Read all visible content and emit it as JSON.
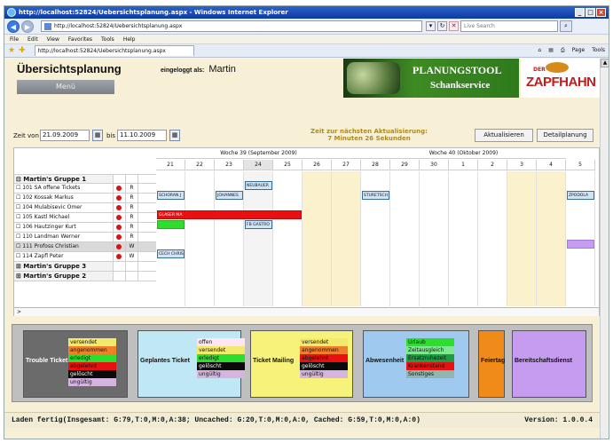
{
  "browser": {
    "title": "http://localhost:52824/Uebersichtsplanung.aspx - Windows Internet Explorer",
    "url": "http://localhost:52824/Uebersichtsplanung.aspx",
    "search_placeholder": "Live Search",
    "menu": [
      "File",
      "Edit",
      "View",
      "Favorites",
      "Tools",
      "Help"
    ],
    "tab_label": "http://localhost:52824/Uebersichtsplanung.aspx",
    "tools": [
      "Page",
      "Tools"
    ]
  },
  "header": {
    "title": "Übersichtsplanung",
    "menu_button": "Menü",
    "login_label": "eingeloggt als:",
    "user": "Martin",
    "banner_line1": "PLANUNGSTOOL",
    "banner_line2": "Schankservice",
    "logo_der": "DER",
    "logo_name": "ZAPFHAHN"
  },
  "toolbar": {
    "from_label": "Zeit von",
    "from_value": "21.09.2009",
    "to_label": "bis",
    "to_value": "11.10.2009",
    "countdown_line1": "Zeit zur nächsten Aktualisierung:",
    "countdown_line2": "7 Minuten 26 Sekunden",
    "refresh_button": "Aktualisieren",
    "detail_button": "Detailplanung"
  },
  "grid": {
    "weeks": [
      {
        "label": "Woche 39 (September 2009)",
        "start": 0,
        "span": 7
      },
      {
        "label": "Woche 40 (Oktober 2009)",
        "start": 7,
        "span": 7
      }
    ],
    "days": [
      "21",
      "22",
      "23",
      "24",
      "25",
      "26",
      "27",
      "28",
      "29",
      "30",
      "1",
      "2",
      "3",
      "4",
      "5"
    ],
    "today_index": 3,
    "weekend_indices": [
      5,
      6,
      12,
      13
    ],
    "rows": [
      {
        "name": "Martin's Gruppe 1",
        "group": true,
        "prefix": "⊟"
      },
      {
        "name": "101 SA offene Tickets",
        "dot": true,
        "status": "R",
        "prefix": "☐"
      },
      {
        "name": "102 Kossak Markus",
        "dot": true,
        "status": "R",
        "prefix": "☐"
      },
      {
        "name": "104 Mulabisevic Omer",
        "dot": true,
        "status": "R",
        "prefix": "☐"
      },
      {
        "name": "105 Kastl Michael",
        "dot": true,
        "status": "R",
        "prefix": "☐"
      },
      {
        "name": "106 Hautzinger Kurt",
        "dot": true,
        "status": "R",
        "prefix": "☐"
      },
      {
        "name": "110 Landman Werner",
        "dot": true,
        "status": "R",
        "prefix": "☐"
      },
      {
        "name": "111 Profoss Christian",
        "dot": true,
        "status": "W",
        "prefix": "☐",
        "highlight": true
      },
      {
        "name": "114 Zapfl Peter",
        "dot": true,
        "status": "W",
        "prefix": "☐"
      },
      {
        "name": "Martin's Gruppe 3",
        "group": true,
        "prefix": "⊞"
      },
      {
        "name": "Martin's Gruppe 2",
        "group": true,
        "prefix": "⊞"
      }
    ],
    "events": [
      {
        "row": 1,
        "start": 3,
        "span": 1,
        "label": "NEUBAUER",
        "kind": "blue"
      },
      {
        "row": 2,
        "start": 0,
        "span": 1,
        "label": "SCHORAN J",
        "kind": "blue"
      },
      {
        "row": 2,
        "start": 2,
        "span": 1,
        "label": "JOHANNES",
        "kind": "blue"
      },
      {
        "row": 2,
        "start": 7,
        "span": 1,
        "label": "STURETSCH",
        "kind": "blue"
      },
      {
        "row": 2,
        "start": 14,
        "span": 1,
        "label": "ZPODOLA",
        "kind": "blue"
      },
      {
        "row": 4,
        "start": 0,
        "span": 5,
        "label": "GLASER MA",
        "kind": "red"
      },
      {
        "row": 5,
        "start": 0,
        "span": 1,
        "label": "",
        "kind": "green"
      },
      {
        "row": 5,
        "start": 3,
        "span": 1,
        "label": "FB GASTRO",
        "kind": "blue"
      },
      {
        "row": 7,
        "start": 14,
        "span": 1,
        "label": "",
        "kind": "violet"
      },
      {
        "row": 8,
        "start": 0,
        "span": 1,
        "label": "CECH CHRIS",
        "kind": "blue"
      }
    ],
    "footer_marker": ">"
  },
  "legend": {
    "trouble": {
      "title": "Trouble Ticket",
      "color": "#6b6b6b",
      "items": [
        {
          "label": "versendet",
          "color": "#f3e96b"
        },
        {
          "label": "angenommen",
          "color": "#f07f2a"
        },
        {
          "label": "erledigt",
          "color": "#2ede2e"
        },
        {
          "label": "abgelehnt",
          "color": "#e81010"
        },
        {
          "label": "gelöscht",
          "color": "#0a0a0a",
          "text_color": "#ffffff"
        },
        {
          "label": "ungültig",
          "color": "#d6b4e0"
        }
      ]
    },
    "planned": {
      "title": "Geplantes Ticket",
      "color": "#bfe7f4",
      "items": [
        {
          "label": "offen",
          "color": "#ffe6f2"
        },
        {
          "label": "versendet",
          "color": "#f3e96b"
        },
        {
          "label": "erledigt",
          "color": "#2ede2e"
        },
        {
          "label": "gelöscht",
          "color": "#0a0a0a",
          "text_color": "#ffffff"
        },
        {
          "label": "ungültig",
          "color": "#d6b4e0"
        }
      ]
    },
    "mailing": {
      "title": "Ticket Mailing",
      "color": "#f6f27a",
      "items": [
        {
          "label": "versendet",
          "color": "#f3e96b"
        },
        {
          "label": "angenommen",
          "color": "#f07f2a"
        },
        {
          "label": "abgelehnt",
          "color": "#e81010"
        },
        {
          "label": "gelöscht",
          "color": "#0a0a0a",
          "text_color": "#ffffff"
        },
        {
          "label": "ungültig",
          "color": "#d6b4e0"
        }
      ]
    },
    "absence": {
      "title": "Abwesenheit",
      "color": "#9fc9ee",
      "items": [
        {
          "label": "Urlaub",
          "color": "#2ede2e"
        },
        {
          "label": "Zeitausgleich",
          "color": "#7ee88f"
        },
        {
          "label": "Ersatzruhezeit",
          "color": "#1f9c43"
        },
        {
          "label": "Krankenstand",
          "color": "#e81010"
        },
        {
          "label": "Sonstiges",
          "color": "#8fb7b0"
        }
      ]
    },
    "holiday": {
      "title": "Feiertag",
      "color": "#f08a18"
    },
    "standby": {
      "title": "Bereitschaftsdienst",
      "color": "#c69cf0"
    }
  },
  "status": {
    "left": "Laden fertig(Insgesamt: G:79,T:0,M:0,A:38; Uncached: G:20,T:0,M:0,A:0, Cached: G:59,T:0,M:0,A:0)",
    "right": "Version: 1.0.0.4"
  }
}
